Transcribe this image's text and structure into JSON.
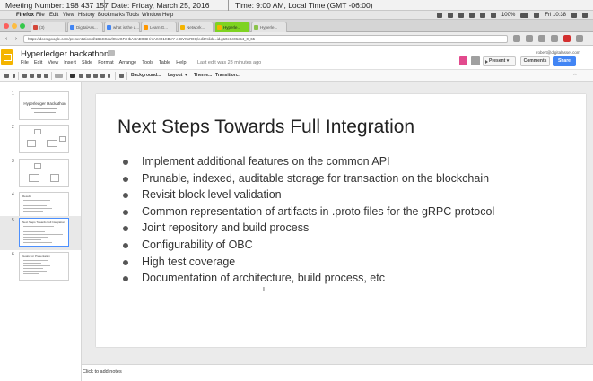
{
  "meeting": {
    "number": "Meeting Number: 198 437 157",
    "date": "Date: Friday, March 25, 2016",
    "time": "Time: 9:00 AM, Local Time (GMT -06:00)"
  },
  "mac_menubar": {
    "items": [
      "Firefox",
      "File",
      "Edit",
      "View",
      "History",
      "Bookmarks",
      "Tools",
      "Window",
      "Help"
    ],
    "battery": "100%",
    "clock": "Fri 10:38"
  },
  "browser": {
    "tabs": [
      {
        "label": "(3)",
        "color": "#d44638"
      },
      {
        "label": "DigitalAss...",
        "color": "#4285f4"
      },
      {
        "label": "what is the d...",
        "color": "#4285f4"
      },
      {
        "label": "Learn G...",
        "color": "#ff9800"
      },
      {
        "label": "Network...",
        "color": "#f4b400"
      },
      {
        "label": "Hyperle...",
        "color": "#f4b400",
        "active": true
      },
      {
        "label": "Hyperle...",
        "color": "#8bc34a"
      }
    ],
    "url": "https://docs.google.com/presentation/d/1B5C9oUlOvvGFrHbAGnD0IBHiYAKrO1XBVY-e-BVKoR0Q/edit#slide=id.g10e8c06c54_0_65"
  },
  "docs": {
    "title": "Hyperledger hackathon",
    "menus": [
      "File",
      "Edit",
      "View",
      "Insert",
      "Slide",
      "Format",
      "Arrange",
      "Tools",
      "Table",
      "Help"
    ],
    "last_edit": "Last edit was 28 minutes ago",
    "email": "robert@digitalasset.com",
    "present_label": "Present",
    "comments_label": "Comments",
    "share_label": "Share"
  },
  "toolbar": {
    "background_label": "Background...",
    "layout_label": "Layout",
    "theme_label": "Theme...",
    "transition_label": "Transition..."
  },
  "filmstrip": {
    "slide1_title": "Hyperledger Hackathon",
    "slide4_title": "Results",
    "slide5_title": "Next Steps Towards Full Integration",
    "slide6_title": "Goals For Presentation"
  },
  "slide": {
    "title": "Next Steps Towards Full Integration",
    "bullets": [
      "Implement additional features on the common API",
      "Prunable, indexed, auditable storage for transaction on the blockchain",
      "Revisit block level validation",
      "Common representation of artifacts in .proto files for the gRPC protocol",
      "Joint repository and build process",
      "Configurability of OBC",
      "High test coverage",
      "Documentation of architecture, build process, etc"
    ]
  },
  "notes": {
    "placeholder": "Click to add notes"
  }
}
